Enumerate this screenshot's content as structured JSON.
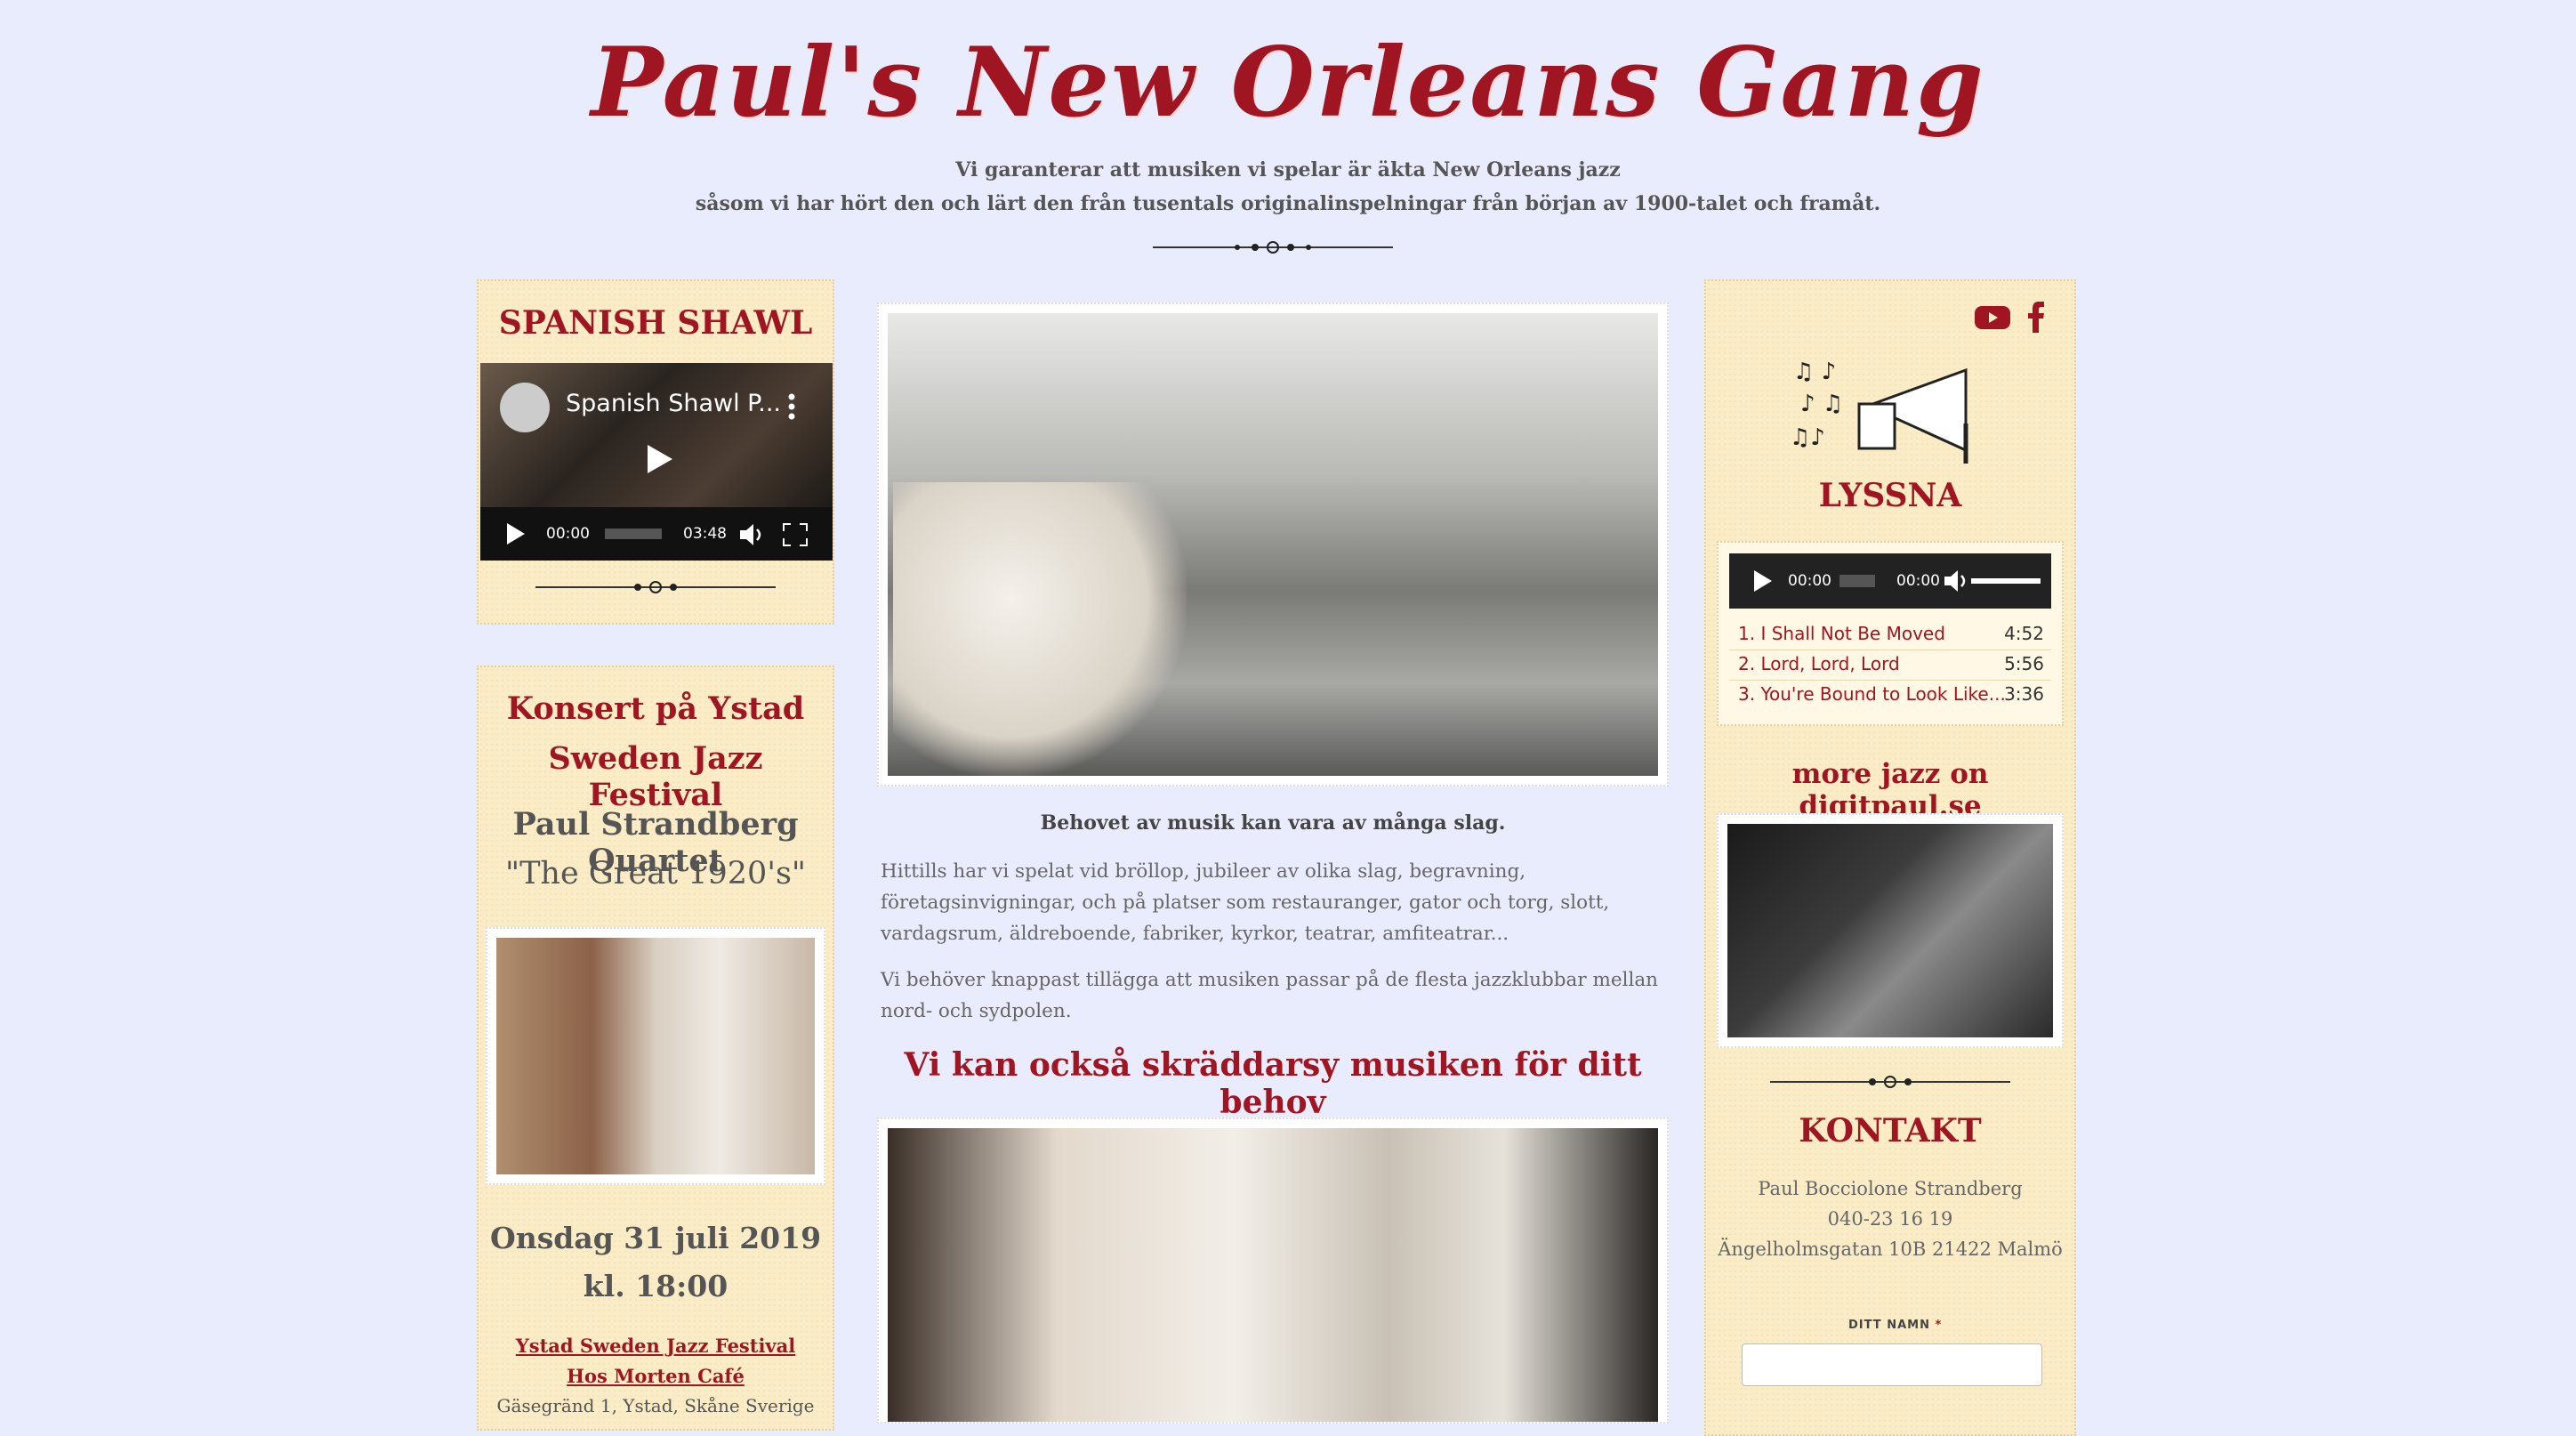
{
  "header": {
    "site_title": "Paul's New Orleans Gang",
    "tagline_line1": "Vi garanterar att musiken vi spelar är äkta New Orleans jazz",
    "tagline_line2": "såsom vi har hört den och lärt den från tusentals originalinspelningar från början av 1900-talet och framåt."
  },
  "left": {
    "video_panel": {
      "title": "SPANISH SHAWL",
      "video_title": "Spanish Shawl P...",
      "time_current": "00:00",
      "time_total": "03:48"
    },
    "concert_panel": {
      "heading_line1": "Konsert på Ystad",
      "heading_line2": "Sweden Jazz Festival",
      "band_line1": "Paul Strandberg Quartet",
      "band_line2": "\"The Great 1920's\"",
      "date": "Onsdag 31 juli 2019",
      "time": "kl. 18:00",
      "link1": "Ystad Sweden Jazz Festival",
      "link2": "Hos Morten Café",
      "address": "Gäsegränd 1, Ystad, Skåne Sverige"
    }
  },
  "main": {
    "intro_bold": "Behovet av musik kan vara av många slag.",
    "para1": "Hittills har vi spelat vid bröllop, jubileer av olika slag, begravning, företagsinvigningar, och på platser som restauranger, gator och torg, slott, vardagsrum, äldreboende, fabriker, kyrkor, teatrar, amfiteatrar...",
    "para2": "Vi behöver knappast tillägga att musiken passar på de flesta jazzklubbar mellan nord- och sydpolen.",
    "subheading": "Vi kan också skräddarsy musiken för ditt behov"
  },
  "right": {
    "listen_title": "LYSSNA",
    "audio_time_current": "00:00",
    "audio_time_total": "00:00",
    "playlist": [
      {
        "name": "1. I Shall Not Be Moved",
        "duration": "4:52"
      },
      {
        "name": "2. Lord, Lord, Lord",
        "duration": "5:56"
      },
      {
        "name": "3. You're Bound to Look Like...",
        "duration": "3:36"
      }
    ],
    "more_jazz": "more jazz on digitpaul.se",
    "contact_title": "KONTAKT",
    "contact_name": "Paul Bocciolone Strandberg",
    "contact_phone": "040-23 16 19",
    "contact_address": "Ängelholmsgatan 10B 21422 Malmö",
    "form_label": "DITT NAMN",
    "form_required": "*",
    "social": [
      "youtube-icon",
      "facebook-icon"
    ]
  },
  "colors": {
    "accent": "#a01522",
    "page_bg": "#e9ecfc",
    "panel_bg": "#faecc6"
  }
}
